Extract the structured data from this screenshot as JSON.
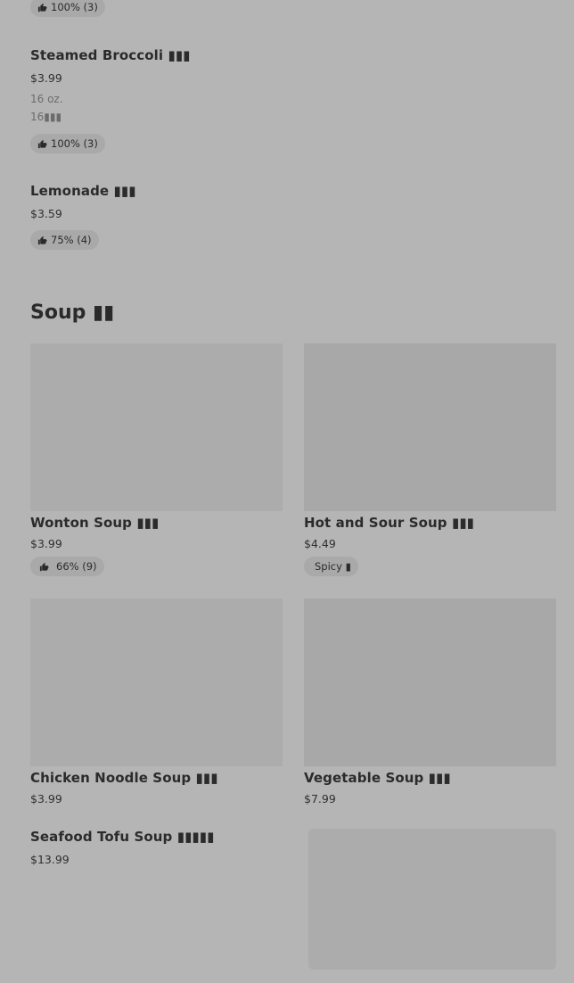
{
  "top_items": [
    {
      "rating": "100% (3)"
    },
    {
      "name": "Steamed Broccoli ▮▮▮",
      "price": "$3.99",
      "size_line1": "16 oz.",
      "size_line2": "16▮▮▮",
      "rating": "100% (3)"
    },
    {
      "name": "Lemonade ▮▮▮",
      "price": "$3.59",
      "rating": "75% (4)"
    }
  ],
  "soup_section": {
    "title": "Soup ▮▮",
    "items": [
      {
        "name": "Wonton Soup ▮▮▮",
        "price": "$3.99",
        "rating": "66% (9)"
      },
      {
        "name": "Hot and Sour Soup ▮▮▮",
        "price": "$4.49",
        "tag": "Spicy ▮"
      },
      {
        "name": "Chicken Noodle Soup ▮▮▮",
        "price": "$3.99"
      },
      {
        "name": "Vegetable Soup ▮▮▮",
        "price": "$7.99"
      },
      {
        "name": "Seafood Tofu Soup ▮▮▮▮▮",
        "price": "$13.99"
      }
    ]
  },
  "icons": {
    "rating": "thumbs-up-icon"
  },
  "colors": {
    "overlay": "#b5b5b5",
    "pill": "#a9a9a9",
    "image": "#a8a8a8"
  }
}
